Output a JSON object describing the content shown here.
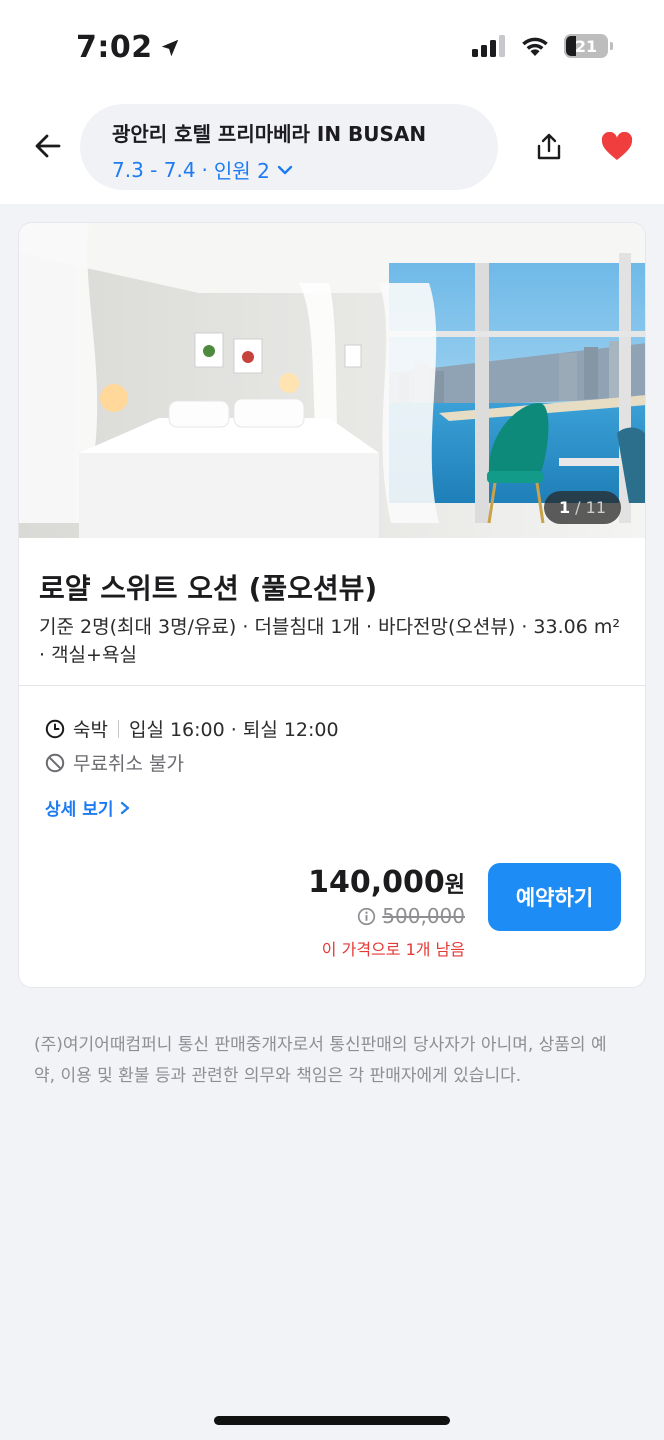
{
  "status_bar": {
    "time": "7:02",
    "battery": "21"
  },
  "header": {
    "hotel_name": "광안리 호텔 프리마베라 IN BUSAN",
    "dates": "7.3 - 7.4",
    "guests": "인원 2",
    "dot": "·",
    "favorite_color": "#f03e3e"
  },
  "room": {
    "image_counter": {
      "current": "1",
      "separator": " / ",
      "total": "11"
    },
    "title": "로얄 스위트 오션 (풀오션뷰)",
    "description": "기준 2명(최대 3명/유료) · 더블침대 1개 · 바다전망(오션뷰) · 33.06 m² · 객실+욕실",
    "stay_type": "숙박",
    "checkin_checkout": "입실 16:00 · 퇴실 12:00",
    "cancellation": "무료취소 불가",
    "detail_link": "상세 보기"
  },
  "pricing": {
    "price": "140,000",
    "price_unit": "원",
    "original_price": "500,000",
    "remaining": "이 가격으로 1개 남음",
    "reserve_label": "예약하기",
    "accent_color": "#1e8cf5",
    "warning_color": "#e53935"
  },
  "footer": {
    "notice": "(주)여기어때컴퍼니 통신 판매중개자로서 통신판매의 당사자가 아니며, 상품의 예약, 이용 및 환불 등과 관련한 의무와 책임은 각 판매자에게 있습니다."
  },
  "icons": {
    "back": "arrow-left-icon",
    "share": "share-icon",
    "favorite": "heart-icon",
    "clock": "clock-icon",
    "no_cancel": "prohibited-icon",
    "info": "info-icon"
  }
}
